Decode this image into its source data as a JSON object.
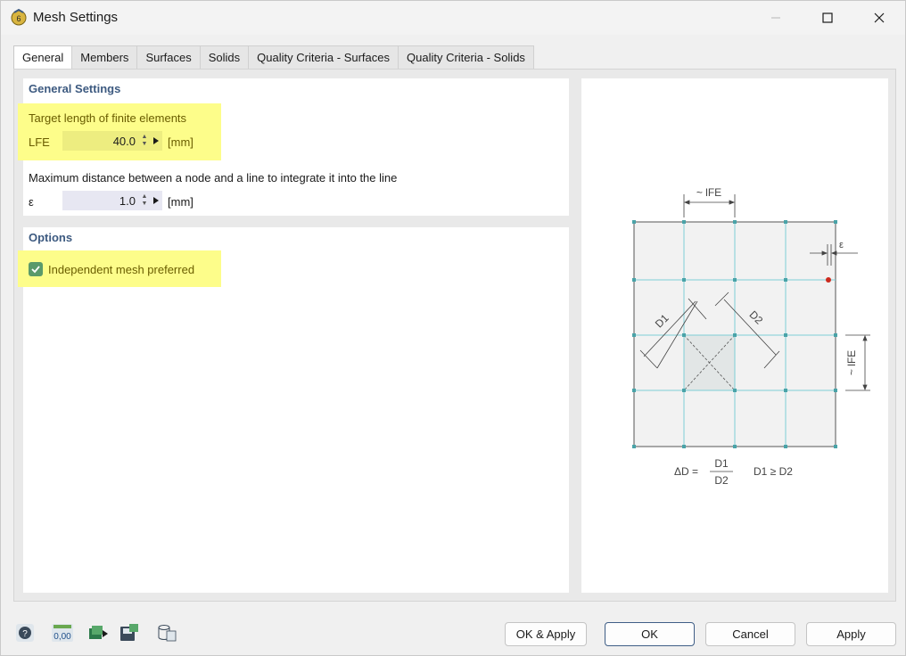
{
  "window": {
    "title": "Mesh Settings"
  },
  "tabs": [
    {
      "label": "General",
      "active": true
    },
    {
      "label": "Members",
      "active": false
    },
    {
      "label": "Surfaces",
      "active": false
    },
    {
      "label": "Solids",
      "active": false
    },
    {
      "label": "Quality Criteria - Surfaces",
      "active": false
    },
    {
      "label": "Quality Criteria - Solids",
      "active": false
    }
  ],
  "general_settings": {
    "title": "General Settings",
    "target_length": {
      "label": "Target length of finite elements",
      "symbol": "LFE",
      "value": "40.0",
      "unit": "[mm]"
    },
    "max_distance": {
      "label": "Maximum distance between a node and a line to integrate it into the line",
      "symbol": "ε",
      "value": "1.0",
      "unit": "[mm]"
    }
  },
  "options": {
    "title": "Options",
    "independent_mesh": {
      "label": "Independent mesh preferred",
      "checked": true
    }
  },
  "diagram": {
    "top_label": "~ lFE",
    "right_label": "~ lFE",
    "epsilon_label": "ε",
    "d1_label": "D1",
    "d2_label": "D2",
    "formula_lhs": "ΔD =",
    "formula_num": "D1",
    "formula_den": "D2",
    "formula_cond": "D1 ≥ D2"
  },
  "buttons": {
    "ok_apply": "OK & Apply",
    "ok": "OK",
    "cancel": "Cancel",
    "apply": "Apply"
  },
  "tool_icons": [
    "help-icon",
    "units-icon",
    "apply-to-model-icon",
    "save-icon",
    "database-icon"
  ],
  "colors": {
    "highlight": "#fdfd8a",
    "section_title": "#3d5a80",
    "mesh_line": "#7fcfd6",
    "node": "#4aa3a8",
    "red_node": "#cc2a1e"
  }
}
